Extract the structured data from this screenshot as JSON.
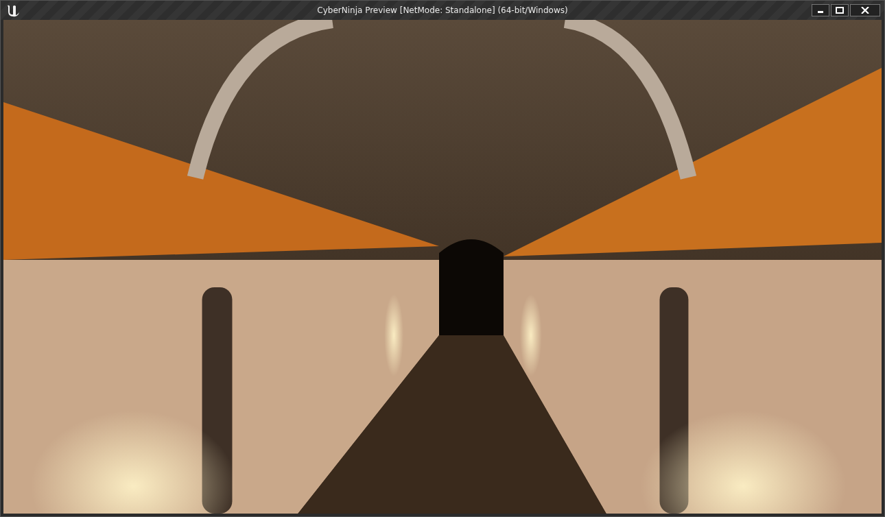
{
  "window": {
    "title": "CyberNinja Preview [NetMode: Standalone] (64-bit/Windows)"
  }
}
